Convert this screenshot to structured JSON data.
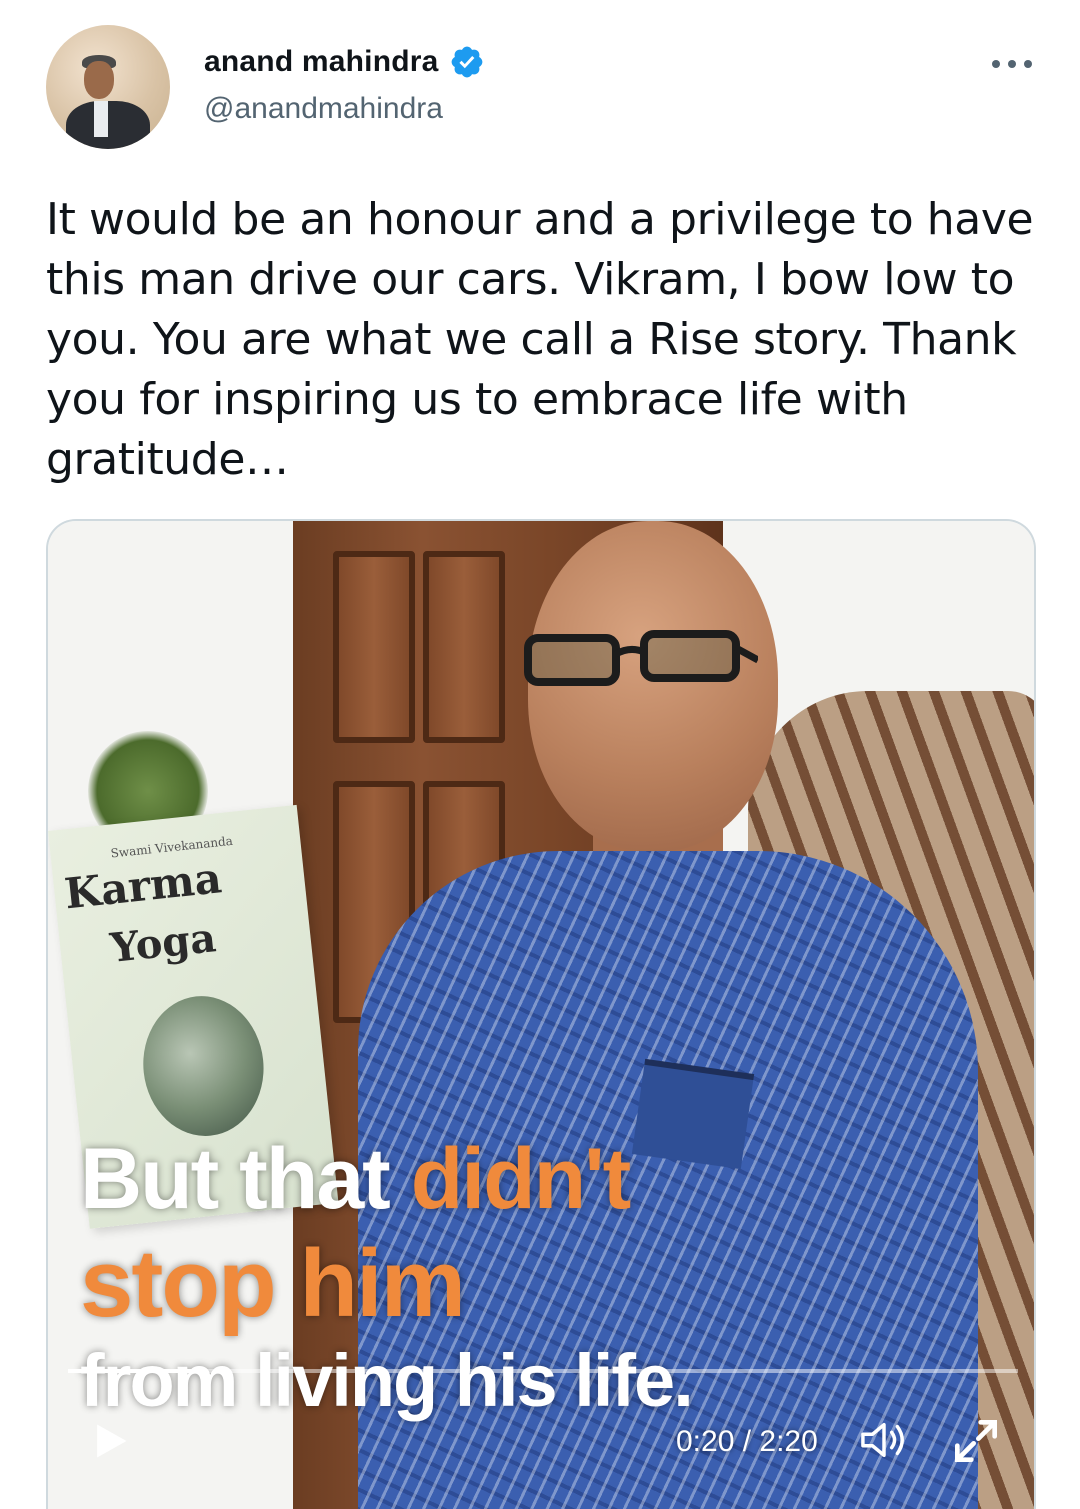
{
  "author": {
    "name": "anand mahindra",
    "handle": "@anandmahindra",
    "verified": true,
    "verified_color": "#1d9bf0"
  },
  "tweet": {
    "text": "It would be an honour and a privilege to have this man drive our cars. Vikram, I bow low to you. You are what we call a Rise story. Thank you for inspiring us to embrace life with gratitude…"
  },
  "video": {
    "book": {
      "subtitle": "Swami Vivekananda",
      "title_line1": "Karma",
      "title_line2": "Yoga"
    },
    "caption": {
      "line1_white": "But that ",
      "line1_orange": "didn't",
      "line2_orange": "stop him",
      "line3_white": "from living his life."
    },
    "current_time": "0:20",
    "separator": " / ",
    "duration": "2:20",
    "progress_fraction": 0.143,
    "accent_orange": "#f08a3c",
    "icons": {
      "play": "play-icon",
      "volume": "volume-icon",
      "fullscreen": "fullscreen-icon",
      "more": "more-icon",
      "verified": "verified-badge-icon"
    }
  }
}
